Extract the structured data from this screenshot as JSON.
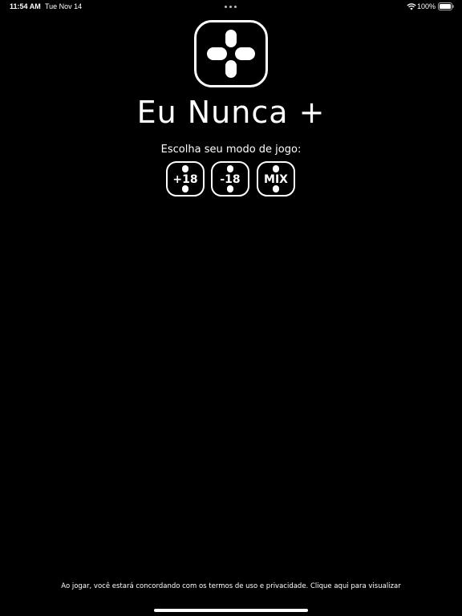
{
  "status_bar": {
    "time": "11:54 AM",
    "date": "Tue Nov 14",
    "battery": "100%",
    "icons": [
      "wifi-icon",
      "battery-icon"
    ]
  },
  "app": {
    "logo_icon": "gamepad-cross-icon",
    "title": "Eu Nunca +"
  },
  "mode_select": {
    "prompt": "Escolha seu modo de jogo:",
    "modes": [
      {
        "label": "+18"
      },
      {
        "label": "-18"
      },
      {
        "label": "MIX"
      }
    ]
  },
  "footer": {
    "terms": "Ao jogar, você estará concordando com os termos de uso e privacidade. Clique aqui para visualizar"
  },
  "colors": {
    "background": "#000000",
    "foreground": "#ffffff"
  }
}
